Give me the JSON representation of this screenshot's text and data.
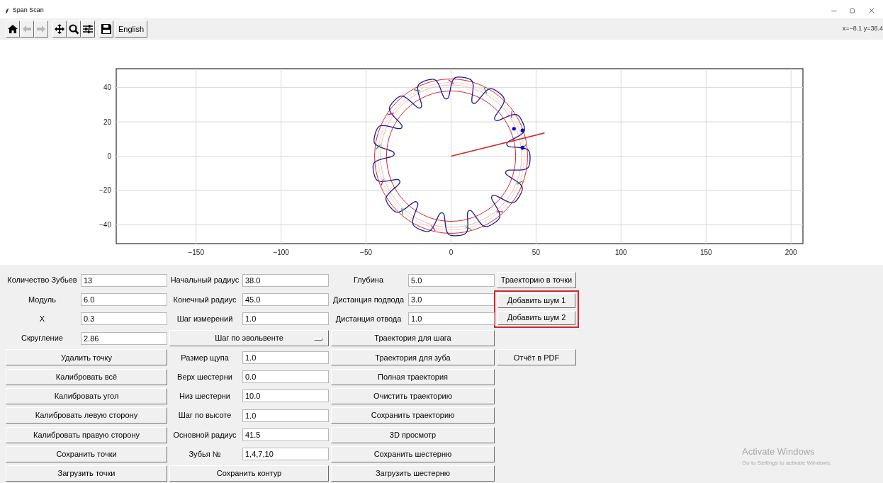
{
  "window": {
    "title": "Span Scan"
  },
  "toolbar": {
    "tools": [
      {
        "kind": "home",
        "disabled": false
      },
      {
        "kind": "back",
        "disabled": true
      },
      {
        "kind": "forward",
        "disabled": true
      },
      {
        "kind": "pan",
        "disabled": false
      },
      {
        "kind": "zoom",
        "disabled": false
      },
      {
        "kind": "configure",
        "disabled": false
      },
      {
        "kind": "save",
        "disabled": false
      },
      {
        "kind": "text",
        "label": "English",
        "disabled": false
      }
    ],
    "coordinates": "x=−8.1 y=38.4"
  },
  "plot": {
    "chart_data": {
      "type": "line",
      "grid": true,
      "xlim": [
        -197,
        207
      ],
      "ylim": [
        -51,
        51
      ],
      "xticks": [
        {
          "value": -150,
          "label": "−150"
        },
        {
          "value": -100,
          "label": "−100"
        },
        {
          "value": -50,
          "label": "−50"
        },
        {
          "value": 0,
          "label": "0"
        },
        {
          "value": 50,
          "label": "50"
        },
        {
          "value": 100,
          "label": "100"
        },
        {
          "value": 150,
          "label": "150"
        },
        {
          "value": 200,
          "label": "200"
        }
      ],
      "yticks": [
        {
          "value": -40,
          "label": "−40"
        },
        {
          "value": -20,
          "label": "−20"
        },
        {
          "value": 0,
          "label": "0"
        },
        {
          "value": 20,
          "label": "20"
        },
        {
          "value": 40,
          "label": "40"
        }
      ],
      "x": [
        0,
        55
      ],
      "series": [
        {
          "color": "#d62728",
          "values": [
            0,
            13.5
          ]
        }
      ]
    }
  },
  "form": {
    "rows": [
      {
        "cells": [
          {
            "kind": "field",
            "label": "Количество Зубьев",
            "value": "13"
          },
          {
            "kind": "field",
            "label": "Начальный радиус",
            "value": "38.0"
          },
          {
            "kind": "field",
            "label": "Глубина",
            "value": "5.0"
          },
          {
            "kind": "button",
            "label": "Траекторию в точки",
            "highlighted": false
          }
        ]
      },
      {
        "cells": [
          {
            "kind": "field",
            "label": "Модуль",
            "value": "6.0"
          },
          {
            "kind": "field",
            "label": "Конечный радиус",
            "value": "45.0"
          },
          {
            "kind": "field",
            "label": "Дистанция подвода",
            "value": "3.0"
          },
          {
            "kind": "button",
            "label": "Добавить шум 1",
            "highlighted": true
          }
        ]
      },
      {
        "cells": [
          {
            "kind": "field",
            "label": "X",
            "value": "0.3"
          },
          {
            "kind": "field",
            "label": "Шаг измерений",
            "value": "1.0"
          },
          {
            "kind": "field",
            "label": "Дистанция отвода",
            "value": "1.0"
          },
          {
            "kind": "button",
            "label": "Добавить шум 2",
            "highlighted": true
          }
        ]
      },
      {
        "cells": [
          {
            "kind": "field",
            "label": "Скругление",
            "value": "2.86"
          },
          {
            "kind": "dropdown",
            "label": "Шаг по эвольвенте"
          },
          {
            "kind": "button",
            "label": "Траектория для шага",
            "highlighted": false
          }
        ]
      },
      {
        "cells": [
          {
            "kind": "button",
            "label": "Удалить точку",
            "highlighted": false
          },
          {
            "kind": "field",
            "label": "Размер щупа",
            "value": "1.0"
          },
          {
            "kind": "button",
            "label": "Траектория для зуба",
            "highlighted": false
          },
          {
            "kind": "button",
            "label": "Отчёт в PDF",
            "highlighted": false
          }
        ]
      },
      {
        "cells": [
          {
            "kind": "button",
            "label": "Калибровать всё",
            "highlighted": false
          },
          {
            "kind": "field",
            "label": "Верх шестерни",
            "value": "0.0"
          },
          {
            "kind": "button",
            "label": "Полная траектория",
            "highlighted": false
          }
        ]
      },
      {
        "cells": [
          {
            "kind": "button",
            "label": "Калибровать угол",
            "highlighted": false
          },
          {
            "kind": "field",
            "label": "Низ шестерни",
            "value": "10.0"
          },
          {
            "kind": "button",
            "label": "Очистить траекторию",
            "highlighted": false
          }
        ]
      },
      {
        "cells": [
          {
            "kind": "button",
            "label": "Калибровать левую сторону",
            "highlighted": false
          },
          {
            "kind": "field",
            "label": "Шаг по высоте",
            "value": "1.0"
          },
          {
            "kind": "button",
            "label": "Сохранить траекторию",
            "highlighted": false
          }
        ]
      },
      {
        "cells": [
          {
            "kind": "button",
            "label": "Калибровать правую сторону",
            "highlighted": false
          },
          {
            "kind": "field",
            "label": "Основной радиус",
            "value": "41.5"
          },
          {
            "kind": "button",
            "label": "3D просмотр",
            "highlighted": false
          }
        ]
      },
      {
        "cells": [
          {
            "kind": "button",
            "label": "Сохранить точки",
            "highlighted": false
          },
          {
            "kind": "field",
            "label": "Зубья №",
            "value": "1,4,7,10"
          },
          {
            "kind": "button",
            "label": "Сохранить шестерню",
            "highlighted": false
          }
        ]
      },
      {
        "cells": [
          {
            "kind": "button",
            "label": "Загрузить точки",
            "highlighted": false
          },
          {
            "kind": "button",
            "label": "Сохранить контур",
            "highlighted": false
          },
          {
            "kind": "button",
            "label": "Загрузить шестерню",
            "highlighted": false
          }
        ]
      }
    ]
  },
  "os_notice": {
    "title": "Activate Windows",
    "subtitle": "Go to Settings to activate Windows."
  }
}
